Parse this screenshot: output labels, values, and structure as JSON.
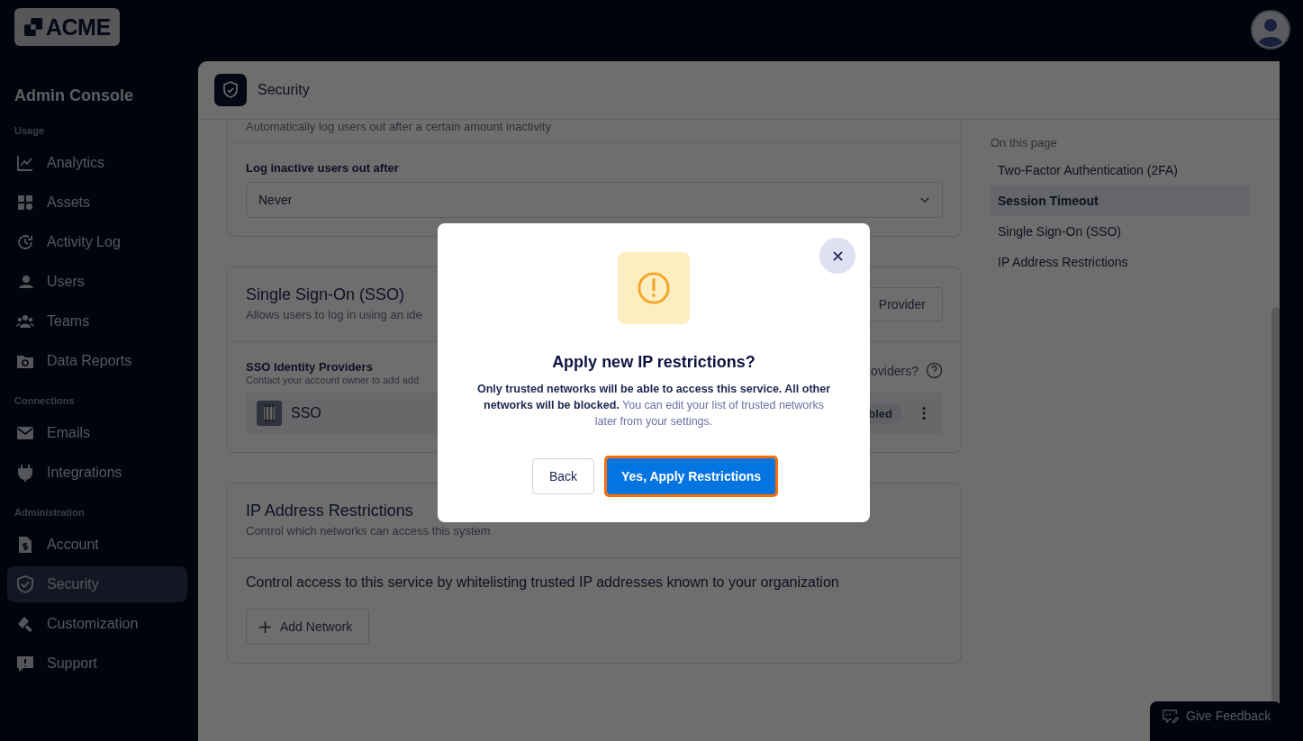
{
  "top_bar": {
    "logo": "ACME"
  },
  "sidebar": {
    "title": "Admin Console",
    "sections": [
      {
        "label": "Usage",
        "items": [
          {
            "label": "Analytics",
            "selected": false
          },
          {
            "label": "Assets",
            "selected": false
          },
          {
            "label": "Activity Log",
            "selected": false
          },
          {
            "label": "Users",
            "selected": false
          },
          {
            "label": "Teams",
            "selected": false
          },
          {
            "label": "Data Reports",
            "selected": false
          }
        ]
      },
      {
        "label": "Connections",
        "items": [
          {
            "label": "Emails",
            "selected": false
          },
          {
            "label": "Integrations",
            "selected": false
          }
        ]
      },
      {
        "label": "Administration",
        "items": [
          {
            "label": "Account",
            "selected": false
          },
          {
            "label": "Security",
            "selected": true
          },
          {
            "label": "Customization",
            "selected": false
          },
          {
            "label": "Support",
            "selected": false
          }
        ]
      }
    ]
  },
  "page": {
    "title": "Security"
  },
  "session_timeout": {
    "description": "Automatically log users out after a certain amount inactivity",
    "field_label": "Log inactive users out after",
    "select_value": "Never"
  },
  "sso": {
    "title": "Single Sign-On (SSO)",
    "description": "Allows users to log in using an ide",
    "add_button": "Provider",
    "providers_label": "SSO Identity Providers",
    "providers_hint": "Contact your account owner to add add",
    "help_text": "oviders?",
    "provider": {
      "name": "SSO",
      "status": "bled"
    }
  },
  "ip_restrictions": {
    "title": "IP Address Restrictions",
    "description": "Control which networks can access this system",
    "text": "Control access to this service by whitelisting trusted IP addresses known to your organization",
    "add_button": "Add Network"
  },
  "toc": {
    "heading": "On this page",
    "items": [
      {
        "label": "Two-Factor Authentication (2FA)",
        "selected": false
      },
      {
        "label": "Session Timeout",
        "selected": true
      },
      {
        "label": "Single Sign-On (SSO)",
        "selected": false
      },
      {
        "label": "IP Address Restrictions",
        "selected": false
      }
    ]
  },
  "dialog": {
    "title": "Apply new IP restrictions?",
    "message_bold": "Only trusted networks will be able to access this service. All other networks will be blocked.",
    "message": "You can edit your list of trusted networks later from your settings.",
    "back_button": "Back",
    "confirm_button": {
      "label": "Yes, Apply Restrictions",
      "focused": true
    }
  },
  "feedback_button": "Give Feedback"
}
